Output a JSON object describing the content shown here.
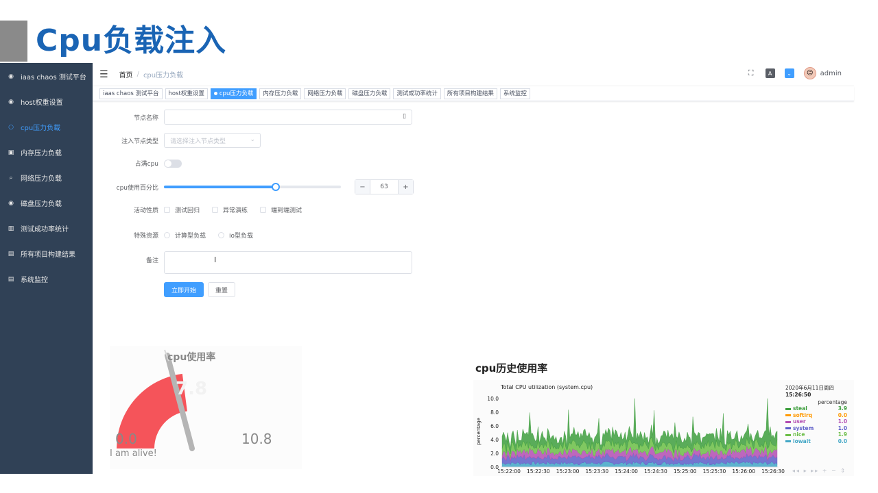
{
  "slide": {
    "title": "Cpu负载注入"
  },
  "sidebar": {
    "items": [
      {
        "label": "iaas chaos 测试平台",
        "icon": "dashboard-icon",
        "glyph": "◉",
        "active": false
      },
      {
        "label": "host权重设置",
        "icon": "dashboard-icon",
        "glyph": "◉",
        "active": false
      },
      {
        "label": "cpu压力负载",
        "icon": "circle-icon",
        "glyph": "○",
        "active": true
      },
      {
        "label": "内存压力负载",
        "icon": "shopping-icon",
        "glyph": "▣",
        "active": false
      },
      {
        "label": "网络压力负载",
        "icon": "search-icon",
        "glyph": "⌕",
        "active": false
      },
      {
        "label": "磁盘压力负载",
        "icon": "dashboard-icon",
        "glyph": "◉",
        "active": false
      },
      {
        "label": "测试成功率统计",
        "icon": "chart-icon",
        "glyph": "▥",
        "active": false
      },
      {
        "label": "所有项目构建结果",
        "icon": "document-icon",
        "glyph": "▤",
        "active": false
      },
      {
        "label": "系统监控",
        "icon": "document-icon",
        "glyph": "▤",
        "active": false
      }
    ]
  },
  "navbar": {
    "breadcrumb_home": "首页",
    "breadcrumb_sep": "/",
    "breadcrumb_current": "cpu压力负载",
    "size_icon_text": "A",
    "lang_icon_text": "⌄",
    "username": "admin"
  },
  "tags": [
    {
      "label": "iaas chaos 测试平台",
      "active": false
    },
    {
      "label": "host权重设置",
      "active": false
    },
    {
      "label": "cpu压力负载",
      "active": true
    },
    {
      "label": "内存压力负载",
      "active": false
    },
    {
      "label": "网络压力负载",
      "active": false
    },
    {
      "label": "磁盘压力负载",
      "active": false
    },
    {
      "label": "测试成功率统计",
      "active": false
    },
    {
      "label": "所有项目构建结果",
      "active": false
    },
    {
      "label": "系统监控",
      "active": false
    }
  ],
  "form": {
    "node_name_label": "节点名称",
    "node_name_value": "",
    "node_type_label": "注入节点类型",
    "node_type_placeholder": "请选择注入节点类型",
    "full_cpu_label": "占满cpu",
    "full_cpu_on": false,
    "cpu_percent_label": "cpu使用百分比",
    "cpu_percent_value": "63",
    "cpu_percent_fraction": 0.63,
    "minus": "−",
    "plus": "+",
    "activity_label": "活动性质",
    "activity_options": [
      "测试回归",
      "异常演练",
      "端到端测试"
    ],
    "resource_label": "特殊资源",
    "resource_options": [
      "计算型负载",
      "io型负载"
    ],
    "remark_label": "备注",
    "remark_value": "",
    "submit_label": "立即开始",
    "reset_label": "重置"
  },
  "gauge": {
    "title": "cpu使用率",
    "value": "7.8",
    "min": "0.0",
    "max": "10.8",
    "note": "I am alive!",
    "min_value": 0,
    "max_value": 10.8,
    "current_value": 7.8,
    "color": "#f5545a"
  },
  "history": {
    "title": "cpu历史使用率",
    "chart_title": "Total CPU utilization (system.cpu)",
    "date": "2020年6月11日周四",
    "time": "15:26:50",
    "unit_header": "percentage",
    "controls": "◂◂ ▸ ▸▸ + −   ⇕"
  },
  "chart_data": {
    "type": "area",
    "title": "Total CPU utilization (system.cpu)",
    "ylabel": "percentage",
    "ylim": [
      0,
      10
    ],
    "yticks": [
      "10.0",
      "8.0",
      "6.0",
      "4.0",
      "2.0",
      "0.0"
    ],
    "xticks": [
      "15:22:00",
      "15:22:30",
      "15:23:00",
      "15:23:30",
      "15:24:00",
      "15:24:30",
      "15:25:00",
      "15:25:30",
      "15:26:00",
      "15:26:30"
    ],
    "series": [
      {
        "name": "steal",
        "value": "3.9",
        "color": "#3d9e3d"
      },
      {
        "name": "softirq",
        "value": "0.0",
        "color": "#ff9900"
      },
      {
        "name": "user",
        "value": "1.0",
        "color": "#b24cb2"
      },
      {
        "name": "system",
        "value": "1.0",
        "color": "#5d5dc8"
      },
      {
        "name": "nice",
        "value": "1.9",
        "color": "#6abd45"
      },
      {
        "name": "iowait",
        "value": "0.0",
        "color": "#41a6c6"
      }
    ]
  }
}
